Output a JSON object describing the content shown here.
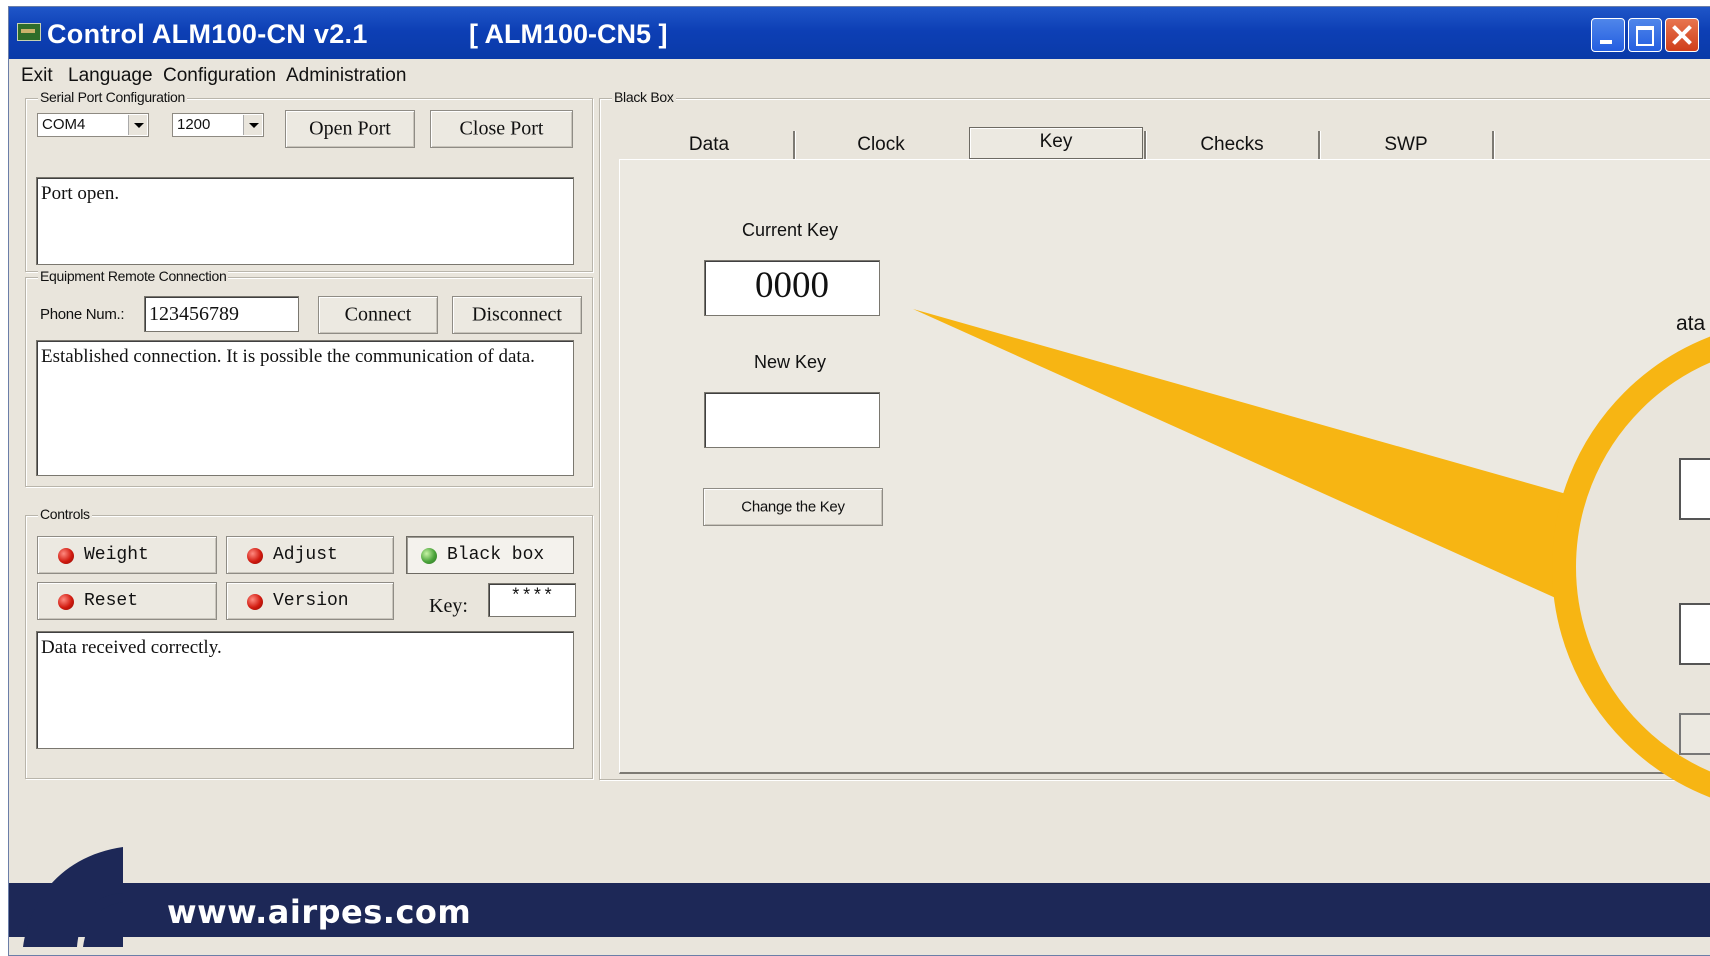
{
  "window": {
    "title": "Control ALM100-CN v2.1",
    "device_title": "[ ALM100-CN5 ]"
  },
  "menu": [
    "Exit",
    "Language",
    "Configuration",
    "Administration"
  ],
  "serial_port": {
    "legend": "Serial Port Configuration",
    "port": "COM4",
    "baud": "1200",
    "open_label": "Open Port",
    "close_label": "Close Port",
    "status": "Port open."
  },
  "remote": {
    "legend": "Equipment Remote Connection",
    "phone_label": "Phone Num.:",
    "phone_value": "123456789",
    "connect_label": "Connect",
    "disconnect_label": "Disconnect",
    "status": "Established connection. It is possible the communication of data."
  },
  "controls": {
    "legend": "Controls",
    "weight_label": "Weight",
    "adjust_label": "Adjust",
    "blackbox_label": "Black box",
    "reset_label": "Reset",
    "version_label": "Version",
    "key_label": "Key:",
    "key_value": "****",
    "status": "Data received correctly."
  },
  "blackbox": {
    "legend": "Black Box",
    "tabs": [
      "Data",
      "Clock",
      "Key",
      "Checks",
      "SWP"
    ],
    "active_tab": "Key",
    "current_key_label": "Current Key",
    "current_key_value": "0000",
    "new_key_label": "New Key",
    "new_key_value": "",
    "change_key_label": "Change the Key",
    "zoom_partial_text": "ata"
  },
  "footer": {
    "website": "www.airpes.com"
  },
  "colors": {
    "titlebar": "#0d3fb5",
    "window_bg": "#e9e5dc",
    "footer_bg": "#1d2857",
    "callout": "#f7b513",
    "led_red": "#d11a0f",
    "led_green": "#4aa33a"
  }
}
